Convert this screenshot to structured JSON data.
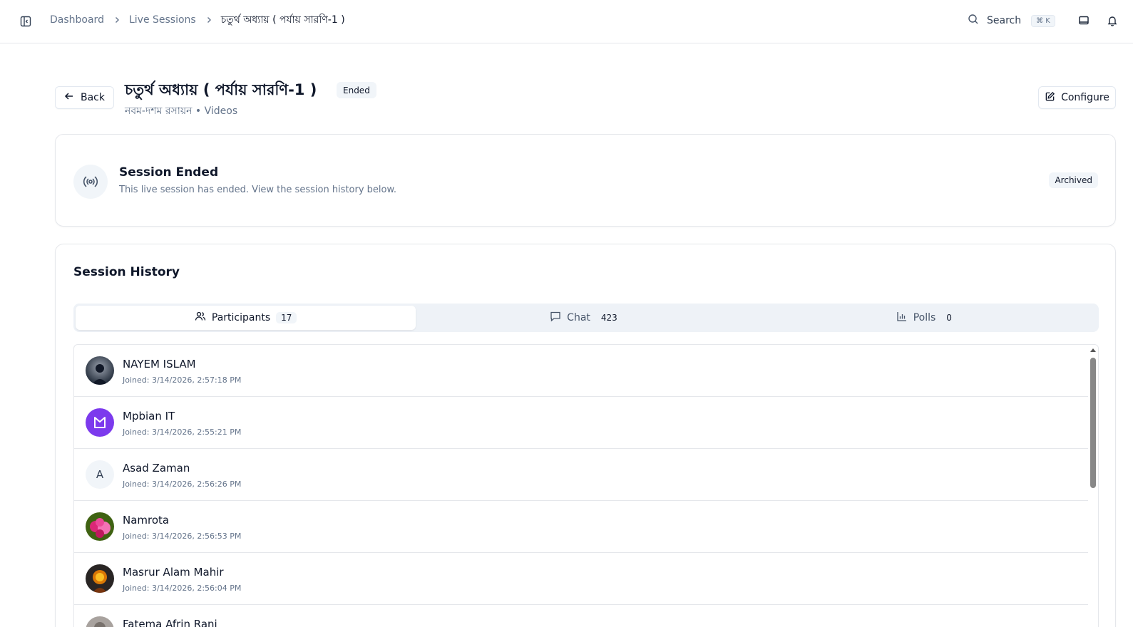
{
  "breadcrumb": {
    "items": [
      "Dashboard",
      "Live Sessions"
    ],
    "current": "চতুর্থ অধ্যায় ( পর্যায় সারণি-1 )"
  },
  "search": {
    "label": "Search",
    "shortcut": "⌘ K"
  },
  "header": {
    "back_label": "Back",
    "title": "চতুর্থ অধ্যায় ( পর্যায় সারণি-1 )",
    "status": "Ended",
    "subtitle": "নবম-দশম রসায়ন • Videos",
    "configure_label": "Configure"
  },
  "ended": {
    "title": "Session Ended",
    "description": "This live session has ended. View the session history below.",
    "badge": "Archived"
  },
  "history": {
    "title": "Session History",
    "tabs": [
      {
        "label": "Participants",
        "count": "17",
        "icon": "users-icon",
        "active": true
      },
      {
        "label": "Chat",
        "count": "423",
        "icon": "chat-icon",
        "active": false
      },
      {
        "label": "Polls",
        "count": "0",
        "icon": "bar-chart-icon",
        "active": false
      }
    ],
    "participants": [
      {
        "name": "NAYEM ISLAM",
        "joined": "Joined: 3/14/2026, 2:57:18 PM",
        "avatar": "photo"
      },
      {
        "name": "Mpbian IT",
        "joined": "Joined: 3/14/2026, 2:55:21 PM",
        "avatar": "logo"
      },
      {
        "name": "Asad Zaman",
        "joined": "Joined: 3/14/2026, 2:56:26 PM",
        "avatar": "A"
      },
      {
        "name": "Namrota",
        "joined": "Joined: 3/14/2026, 2:56:53 PM",
        "avatar": "photo"
      },
      {
        "name": "Masrur Alam Mahir",
        "joined": "Joined: 3/14/2026, 2:56:04 PM",
        "avatar": "photo"
      },
      {
        "name": "Fatema Afrin Rani",
        "joined": "",
        "avatar": "photo"
      }
    ]
  },
  "colors": {
    "accent": "#0f172a",
    "muted": "#64748b",
    "tab_bg": "#eef2f7",
    "logo_purple": "#7c3aed"
  }
}
